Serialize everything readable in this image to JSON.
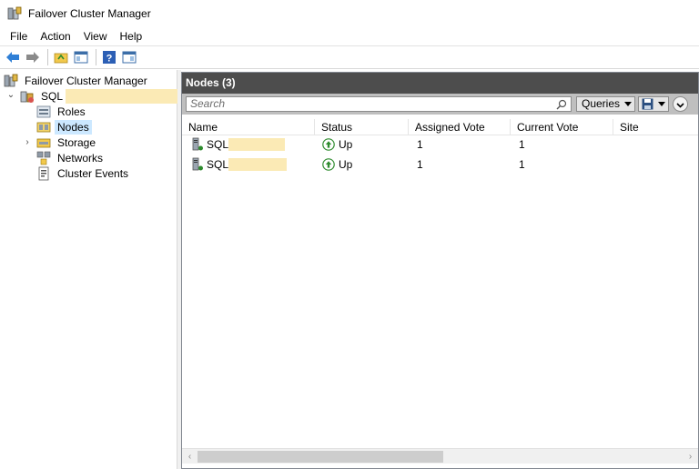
{
  "window": {
    "title": "Failover Cluster Manager"
  },
  "menu": [
    "File",
    "Action",
    "View",
    "Help"
  ],
  "toolbar": {
    "buttons": [
      "back-arrow-icon",
      "forward-arrow-icon",
      "up-folder-icon",
      "show-hide-console-tree-icon",
      "help-icon",
      "show-action-pane-icon"
    ]
  },
  "tree": {
    "root": "Failover Cluster Manager",
    "cluster": "SQL",
    "items": [
      "Roles",
      "Nodes",
      "Storage",
      "Networks",
      "Cluster Events"
    ],
    "selected": "Nodes"
  },
  "content": {
    "title": "Nodes (3)",
    "search_placeholder": "Search",
    "queries_label": "Queries",
    "columns": [
      "Name",
      "Status",
      "Assigned Vote",
      "Current Vote",
      "Site"
    ],
    "rows": [
      {
        "name": "SQL",
        "status": "Up",
        "assigned_vote": "1",
        "current_vote": "1",
        "site": ""
      },
      {
        "name": "SQL",
        "status": "Up",
        "assigned_vote": "1",
        "current_vote": "1",
        "site": ""
      }
    ]
  },
  "colors": {
    "header_bg": "#4d4d4d",
    "searchbar_bg": "#bfbfbf",
    "selected_bg": "#cce8ff",
    "redaction": "#fbeab5",
    "status_green": "#2e8b2e"
  }
}
